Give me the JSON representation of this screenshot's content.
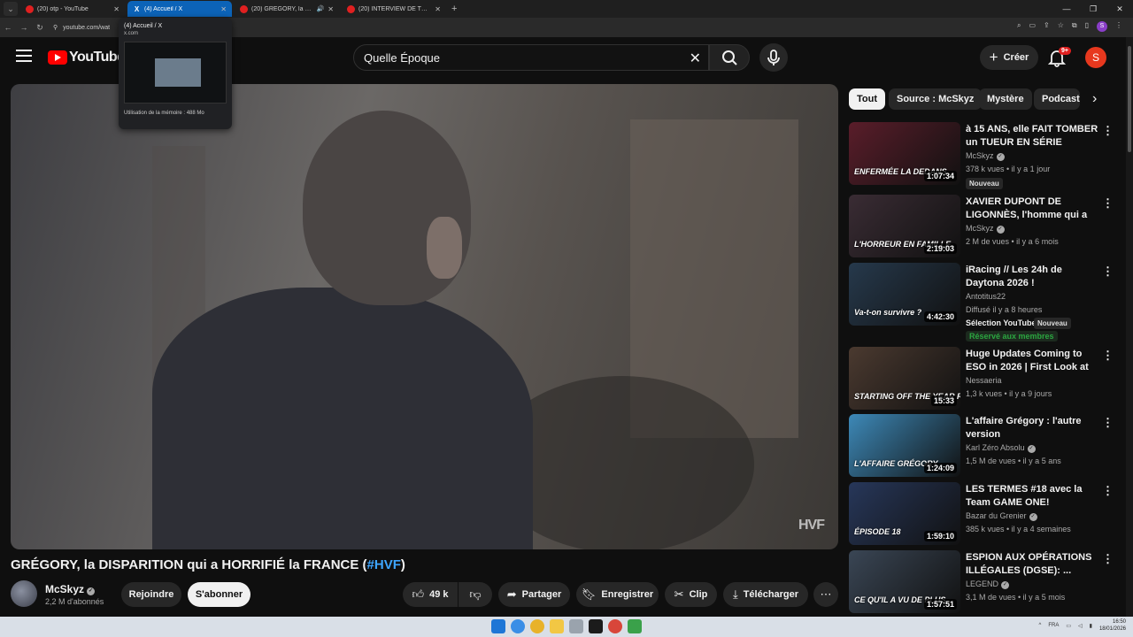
{
  "browser": {
    "tabs": [
      {
        "label": "(20) otp - YouTube",
        "icon": "youtube-icon",
        "active": false
      },
      {
        "label": "(4) Accueil / X",
        "icon": "x-icon",
        "active": true
      },
      {
        "label": "(20) GRÉGORY, la DISPARITI",
        "icon": "youtube-icon",
        "active": false,
        "sound": true
      },
      {
        "label": "(20) INTERVIEW DE TWITCH GA",
        "icon": "youtube-icon",
        "active": false
      }
    ],
    "url": "youtube.com/wat",
    "preview": {
      "title": "(4) Accueil / X",
      "domain": "x.com",
      "memory": "Utilisation de la mémoire : 488 Mo"
    }
  },
  "header": {
    "logo_text": "YouTube",
    "logo_country": "FR",
    "search_value": "Quelle Époque",
    "create_label": "Créer",
    "notif_badge": "9+",
    "avatar_letter": "S"
  },
  "video": {
    "title_main": "GRÉGORY, la DISPARITION qui a HORRIFIÉ la FRANCE (",
    "title_hash": "#HVF",
    "title_end": ")",
    "watermark": "HVF",
    "channel": "McSkyz",
    "subscribers": "2,2 M d'abonnés",
    "join_label": "Rejoindre",
    "subscribe_label": "S'abonner",
    "likes": "49 k",
    "share_label": "Partager",
    "save_label": "Enregistrer",
    "clip_label": "Clip",
    "download_label": "Télécharger"
  },
  "chips": [
    "Tout",
    "Source : McSkyz",
    "Mystère",
    "Podcast"
  ],
  "recommendations": [
    {
      "title": "à 15 ANS, elle FAIT TOMBER un TUEUR EN SÉRIE AMÉRICAIN :...",
      "channel": "McSkyz",
      "verified": true,
      "meta": "378 k vues • il y a 1 jour",
      "duration": "1:07:34",
      "badge": "Nouveau",
      "thumb_text": "ENFERMÉE LA DEDANS",
      "color": "#5a1d2a"
    },
    {
      "title": "XAVIER DUPONT DE LIGONNÈS, l'homme qui a horrifié la Franc...",
      "channel": "McSkyz",
      "verified": true,
      "meta": "2 M de vues • il y a 6 mois",
      "duration": "2:19:03",
      "thumb_text": "L'HORREUR EN FAMILLE",
      "color": "#3a2c34"
    },
    {
      "title": "iRacing // Les 24h de Daytona 2026 !",
      "channel": "Antotitus22",
      "verified": false,
      "meta": "Diffusé il y a 8 heures",
      "duration": "4:42:30",
      "selection": "Sélection YouTube",
      "badge": "Nouveau",
      "members": "Réservé aux membres",
      "thumb_text": "Va-t-on survivre ?",
      "color": "#26394c"
    },
    {
      "title": "Huge Updates Coming to ESO in 2026 | First Look at Update 49 ...",
      "channel": "Nessaeria",
      "verified": false,
      "meta": "1,3 k vues • il y a 9 jours",
      "duration": "15:33",
      "thumb_text": "STARTING OFF THE YEAR RIGHT",
      "color": "#4b3a30"
    },
    {
      "title": "L'affaire Grégory : l'autre version",
      "channel": "Karl Zéro Absolu",
      "verified": true,
      "meta": "1,5 M de vues • il y a 5 ans",
      "duration": "1:24:09",
      "thumb_text": "L'AFFAIRE GRÉGORY",
      "color": "#3d89b8"
    },
    {
      "title": "LES TERMES #18 avec la Team GAME ONE!",
      "channel": "Bazar du Grenier",
      "verified": true,
      "meta": "385 k vues • il y a 4 semaines",
      "duration": "1:59:10",
      "thumb_text": "ÉPISODE 18",
      "color": "#27375a"
    },
    {
      "title": "ESPION AUX OPÉRATIONS ILLÉGALES (DGSE): ...",
      "channel": "LEGEND",
      "verified": true,
      "meta": "3,1 M de vues • il y a 5 mois",
      "duration": "1:57:51",
      "thumb_text": "CE QU'IL A VU DE PLUS",
      "color": "#3a4655"
    }
  ],
  "taskbar": {
    "lang": "FRA",
    "time": "16:50",
    "date": "18/01/2026"
  }
}
